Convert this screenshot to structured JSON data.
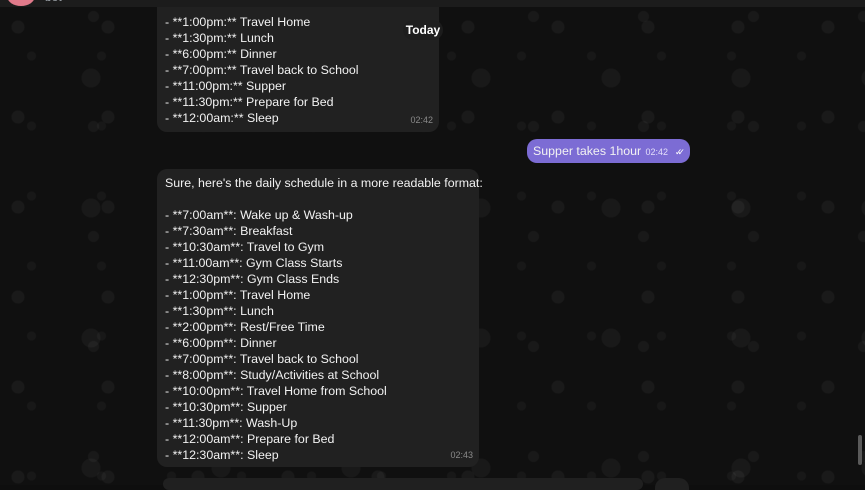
{
  "header": {
    "bot_name": "bot"
  },
  "date_badge": "Today",
  "messages": [
    {
      "direction": "incoming",
      "lines": [
        "- **1:00pm:** Travel Home",
        "- **1:30pm:** Lunch",
        "- **6:00pm:** Dinner",
        "- **7:00pm:** Travel back to School",
        "- **11:00pm:** Supper",
        "- **11:30pm:** Prepare for Bed",
        "- **12:00am:** Sleep"
      ],
      "time": "02:42"
    },
    {
      "direction": "outgoing",
      "text": "Supper takes 1hour",
      "time": "02:42",
      "read_receipt": "✓✓"
    },
    {
      "direction": "incoming",
      "lines": [
        "Sure, here's the daily schedule in a more readable format:",
        "",
        "- **7:00am**: Wake up & Wash-up",
        "- **7:30am**: Breakfast",
        "- **10:30am**: Travel to Gym",
        "- **11:00am**: Gym Class Starts",
        "- **12:30pm**: Gym Class Ends",
        "- **1:00pm**: Travel Home",
        "- **1:30pm**: Lunch",
        "- **2:00pm**: Rest/Free Time",
        "- **6:00pm**: Dinner",
        "- **7:00pm**: Travel back to School",
        "- **8:00pm**: Study/Activities at School",
        "- **10:00pm**: Travel Home from School",
        "- **10:30pm**: Supper",
        "- **11:30pm**: Wash-Up",
        "- **12:00am**: Prepare for Bed",
        "- **12:30am**: Sleep"
      ],
      "time": "02:43"
    }
  ],
  "colors": {
    "outgoing_bubble": "#7c6cd4",
    "incoming_bubble": "#212121",
    "background": "#101010"
  }
}
